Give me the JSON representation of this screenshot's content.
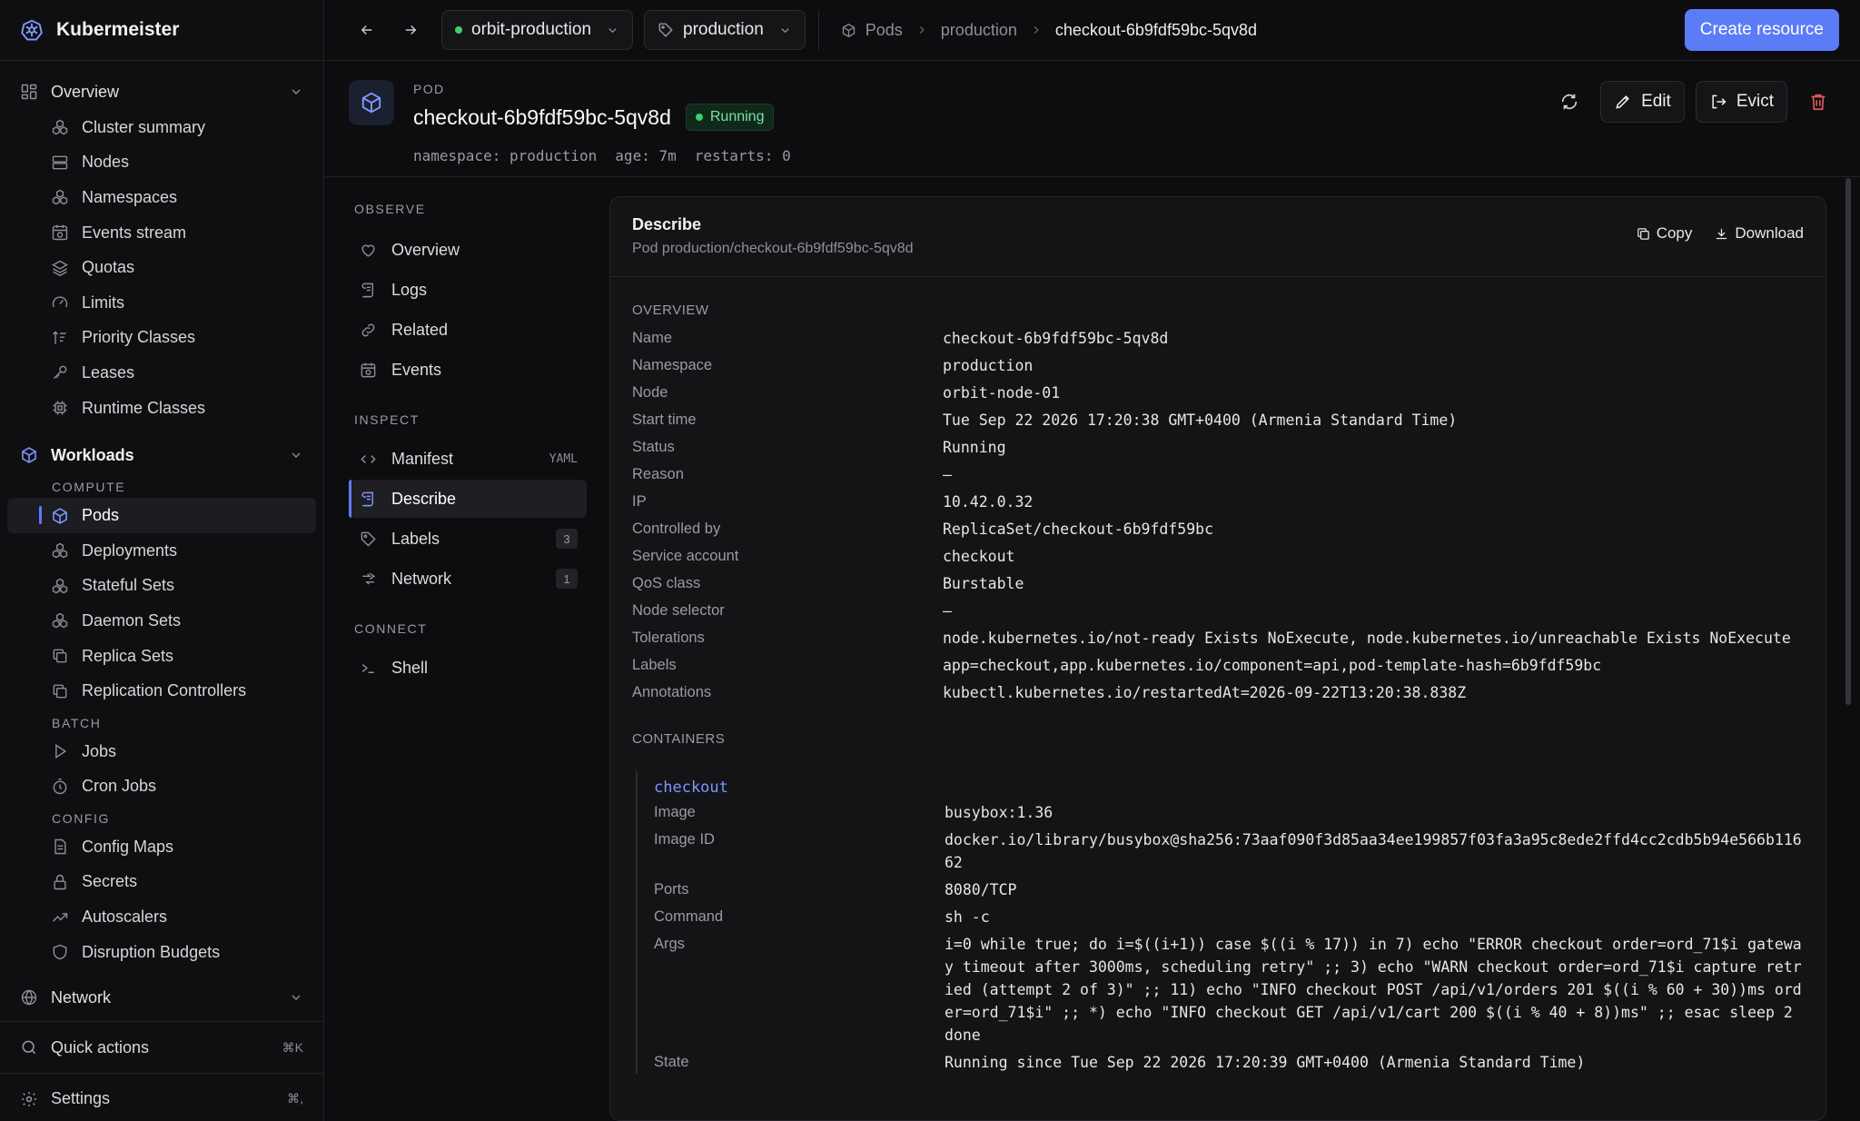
{
  "app": {
    "name": "Kubermeister"
  },
  "sidebar": {
    "overview": {
      "title": "Overview",
      "items": [
        {
          "label": "Cluster summary",
          "icon": "cluster-icon"
        },
        {
          "label": "Nodes",
          "icon": "server-icon"
        },
        {
          "label": "Namespaces",
          "icon": "namespaces-icon"
        },
        {
          "label": "Events stream",
          "icon": "events-icon"
        },
        {
          "label": "Quotas",
          "icon": "layers-icon"
        },
        {
          "label": "Limits",
          "icon": "gauge-icon"
        },
        {
          "label": "Priority Classes",
          "icon": "priority-icon"
        },
        {
          "label": "Leases",
          "icon": "key-icon"
        },
        {
          "label": "Runtime Classes",
          "icon": "chip-icon"
        }
      ]
    },
    "workloads": {
      "title": "Workloads",
      "compute_label": "COMPUTE",
      "compute": [
        "Pods",
        "Deployments",
        "Stateful Sets",
        "Daemon Sets",
        "Replica Sets",
        "Replication Controllers"
      ],
      "batch_label": "BATCH",
      "batch": [
        "Jobs",
        "Cron Jobs"
      ],
      "config_label": "CONFIG",
      "config": [
        "Config Maps",
        "Secrets",
        "Autoscalers",
        "Disruption Budgets"
      ]
    },
    "network": {
      "title": "Network"
    },
    "quick_actions": {
      "label": "Quick actions",
      "shortcut": "⌘K"
    },
    "settings": {
      "label": "Settings",
      "shortcut": "⌘,"
    }
  },
  "topbar": {
    "cluster": "orbit-production",
    "namespace": "production",
    "breadcrumb": [
      "Pods",
      "production",
      "checkout-6b9fdf59bc-5qv8d"
    ],
    "create_label": "Create resource"
  },
  "pod": {
    "kind": "POD",
    "name": "checkout-6b9fdf59bc-5qv8d",
    "status": "Running",
    "meta": [
      "namespace: production",
      "age: 7m",
      "restarts: 0"
    ],
    "actions": {
      "edit": "Edit",
      "evict": "Evict"
    }
  },
  "subnav": {
    "observe_label": "OBSERVE",
    "observe": [
      "Overview",
      "Logs",
      "Related",
      "Events"
    ],
    "inspect_label": "INSPECT",
    "manifest": {
      "label": "Manifest",
      "tail": "YAML"
    },
    "describe": "Describe",
    "labels": {
      "label": "Labels",
      "count": "3"
    },
    "network": {
      "label": "Network",
      "count": "1"
    },
    "connect_label": "CONNECT",
    "shell": "Shell"
  },
  "describe": {
    "title": "Describe",
    "subtitle": "Pod production/checkout-6b9fdf59bc-5qv8d",
    "copy": "Copy",
    "download": "Download",
    "overview_label": "OVERVIEW",
    "overview": [
      {
        "k": "Name",
        "v": "checkout-6b9fdf59bc-5qv8d"
      },
      {
        "k": "Namespace",
        "v": "production"
      },
      {
        "k": "Node",
        "v": "orbit-node-01"
      },
      {
        "k": "Start time",
        "v": "Tue Sep 22 2026 17:20:38 GMT+0400 (Armenia Standard Time)"
      },
      {
        "k": "Status",
        "v": "Running"
      },
      {
        "k": "Reason",
        "v": "—"
      },
      {
        "k": "IP",
        "v": "10.42.0.32"
      },
      {
        "k": "Controlled by",
        "v": "ReplicaSet/checkout-6b9fdf59bc"
      },
      {
        "k": "Service account",
        "v": "checkout"
      },
      {
        "k": "QoS class",
        "v": "Burstable"
      },
      {
        "k": "Node selector",
        "v": "—"
      },
      {
        "k": "Tolerations",
        "v": "node.kubernetes.io/not-ready Exists NoExecute, node.kubernetes.io/unreachable Exists NoExecute"
      },
      {
        "k": "Labels",
        "v": "app=checkout,app.kubernetes.io/component=api,pod-template-hash=6b9fdf59bc"
      },
      {
        "k": "Annotations",
        "v": "kubectl.kubernetes.io/restartedAt=2026-09-22T13:20:38.838Z"
      }
    ],
    "containers_label": "CONTAINERS",
    "container": {
      "name": "checkout",
      "fields": [
        {
          "k": "Image",
          "v": "busybox:1.36"
        },
        {
          "k": "Image ID",
          "v": "docker.io/library/busybox@sha256:73aaf090f3d85aa34ee199857f03fa3a95c8ede2ffd4cc2cdb5b94e566b11662"
        },
        {
          "k": "Ports",
          "v": "8080/TCP"
        },
        {
          "k": "Command",
          "v": "sh -c"
        },
        {
          "k": "Args",
          "v": "i=0 while true; do i=$((i+1)) case $((i % 17)) in 7) echo \"ERROR checkout order=ord_71$i gateway timeout after 3000ms, scheduling retry\" ;; 3) echo \"WARN checkout order=ord_71$i capture retried (attempt 2 of 3)\" ;; 11) echo \"INFO checkout POST /api/v1/orders 201 $((i % 60 + 30))ms order=ord_71$i\" ;; *) echo \"INFO checkout GET /api/v1/cart 200 $((i % 40 + 8))ms\" ;; esac sleep 2 done"
        },
        {
          "k": "State",
          "v": "Running since Tue Sep 22 2026 17:20:39 GMT+0400 (Armenia Standard Time)"
        }
      ]
    }
  },
  "colors": {
    "accent": "#5b7cf7",
    "running": "#3ecf6e",
    "danger": "#e35a5a"
  }
}
